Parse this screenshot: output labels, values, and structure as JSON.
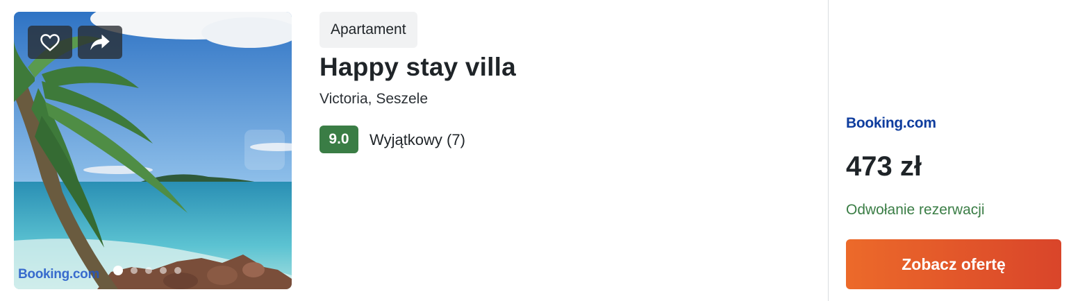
{
  "listing": {
    "type_badge": "Apartament",
    "title": "Happy stay villa",
    "location": "Victoria, Seszele",
    "rating": {
      "score": "9.0",
      "label": "Wyjątkowy (7)"
    },
    "photo": {
      "watermark": "Booking.com",
      "dots_count": 5,
      "active_dot": 0
    }
  },
  "offer": {
    "provider": "Booking.com",
    "price": "473 zł",
    "cancellation": "Odwołanie rezerwacji",
    "cta_label": "Zobacz ofertę"
  },
  "icons": {
    "favorite": "heart-icon",
    "share": "share-arrow-icon"
  },
  "colors": {
    "rating_green": "#3a7d45",
    "cta_orange": "#e8602a",
    "provider_blue": "#0f3d9e"
  }
}
